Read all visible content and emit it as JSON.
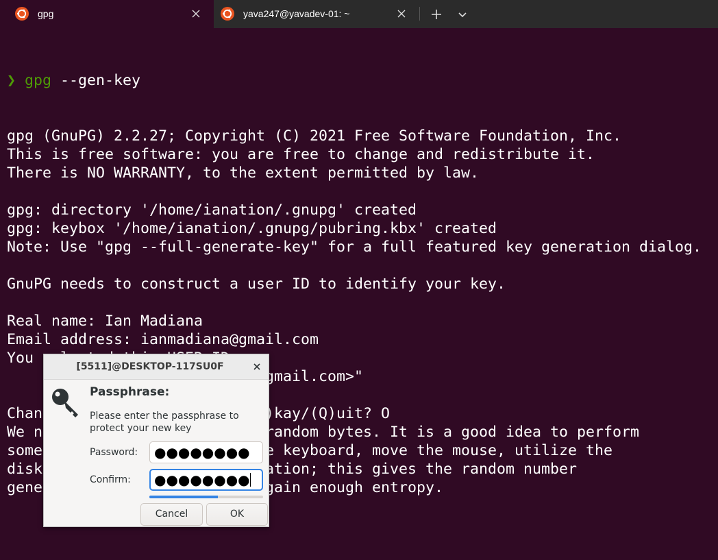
{
  "tabs": [
    {
      "label": "gpg",
      "icon": "ubuntu-icon",
      "active": true
    },
    {
      "label": "yava247@yavadev-01: ~",
      "icon": "ubuntu-icon",
      "active": false
    }
  ],
  "tabbar": {
    "new_tab_icon": "plus-icon",
    "dropdown_icon": "chevron-down-icon"
  },
  "terminal": {
    "prompt_symbol": "❯",
    "command_name": "gpg",
    "command_args": " --gen-key",
    "lines": [
      "gpg (GnuPG) 2.2.27; Copyright (C) 2021 Free Software Foundation, Inc.",
      "This is free software: you are free to change and redistribute it.",
      "There is NO WARRANTY, to the extent permitted by law.",
      "",
      "gpg: directory '/home/ianation/.gnupg' created",
      "gpg: keybox '/home/ianation/.gnupg/pubring.kbx' created",
      "Note: Use \"gpg --full-generate-key\" for a full featured key generation dialog.",
      "",
      "GnuPG needs to construct a user ID to identify your key.",
      "",
      "Real name: Ian Madiana",
      "Email address: ianmadiana@gmail.com",
      "You selected this USER-ID:",
      "    \"Ian Madiana <ianmadiana@gmail.com>\"",
      "",
      "Change (N)ame, (E)mail, or (O)kay/(Q)uit? O",
      "We need to generate a lot of random bytes. It is a good idea to perform",
      "some other action (type on the keyboard, move the mouse, utilize the",
      "disks) during the prime generation; this gives the random number",
      "generator a better chance to gain enough entropy."
    ]
  },
  "dialog": {
    "title": "[5511]@DESKTOP-117SU0F",
    "heading": "Passphrase:",
    "description": "Please enter the passphrase to protect your new key",
    "password_label": "Password:",
    "password_value": "●●●●●●●●",
    "confirm_label": "Confirm:",
    "confirm_value": "●●●●●●●●",
    "quality_fraction": 0.6,
    "cancel_label": "Cancel",
    "ok_label": "OK",
    "icon": "key-icon"
  },
  "colors": {
    "terminal_bg": "#300a24",
    "prompt_green": "#4e9a06",
    "accent_blue": "#3584e4",
    "ubuntu_orange": "#e95420"
  }
}
